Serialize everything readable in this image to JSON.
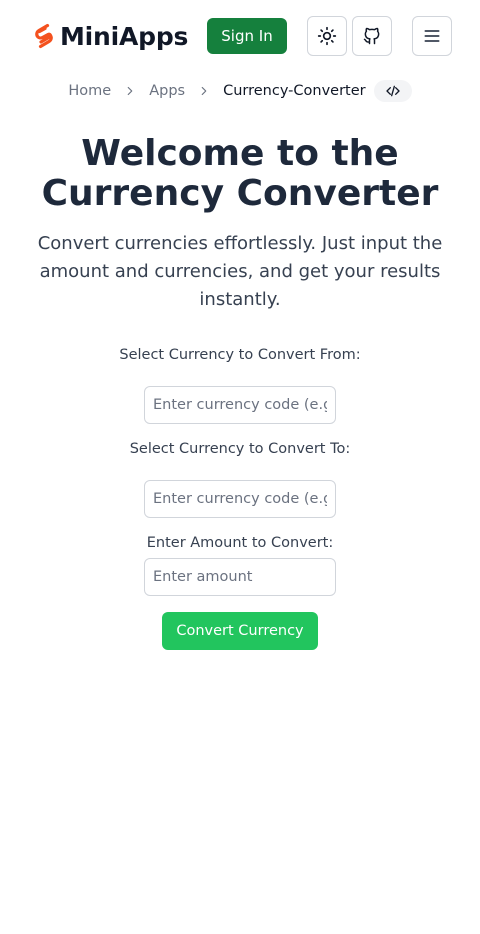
{
  "header": {
    "logo_text": "MiniApps",
    "sign_in_label": "Sign In",
    "theme_icon": "sun-icon",
    "github_icon": "github-icon",
    "menu_icon": "hamburger-menu-icon"
  },
  "breadcrumb": {
    "items": [
      "Home",
      "Apps",
      "Currency-Converter"
    ],
    "code_icon": "code-icon"
  },
  "main": {
    "title": "Welcome to the Currency Converter",
    "subtitle": "Convert currencies effortlessly. Just input the amount and currencies, and get your results instantly."
  },
  "form": {
    "from_label": "Select Currency to Convert From:",
    "from_placeholder": "Enter currency code (e.g., USD)",
    "to_label": "Select Currency to Convert To:",
    "to_placeholder": "Enter currency code (e.g., EUR)",
    "amount_label": "Enter Amount to Convert:",
    "amount_placeholder": "Enter amount",
    "convert_label": "Convert Currency"
  },
  "colors": {
    "brand_orange": "#f4511e",
    "sign_in_bg": "#15803d",
    "convert_bg": "#22c55e",
    "title_color": "#1e293b"
  }
}
